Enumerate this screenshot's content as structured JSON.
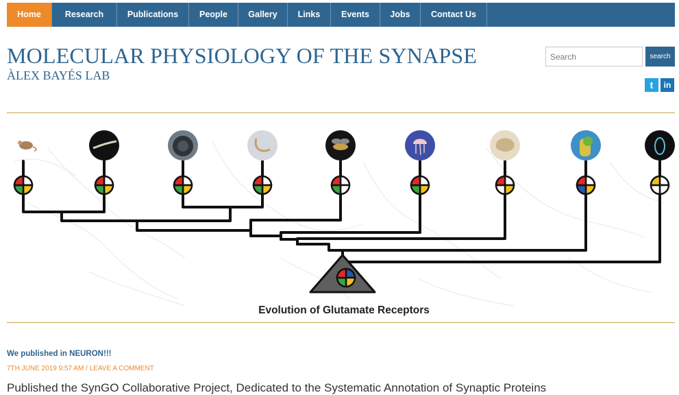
{
  "nav": {
    "items": [
      {
        "label": "Home",
        "active": true
      },
      {
        "label": "Research"
      },
      {
        "label": "Publications"
      },
      {
        "label": "People"
      },
      {
        "label": "Gallery"
      },
      {
        "label": "Links"
      },
      {
        "label": "Events"
      },
      {
        "label": "Jobs"
      },
      {
        "label": "Contact Us"
      }
    ]
  },
  "header": {
    "title": "MOLECULAR PHYSIOLOGY OF THE SYNAPSE",
    "subtitle": "ÀLEX BAYÉS LAB"
  },
  "search": {
    "placeholder": "Search",
    "button_label": "search"
  },
  "social": {
    "twitter_icon": "t",
    "linkedin_icon": "in"
  },
  "banner": {
    "caption": "Evolution of Glutamate Receptors"
  },
  "post": {
    "title": "We published in NEURON!!!",
    "date": "7th June 2019 9:57 am",
    "separator": "/",
    "comment_link": "LEAVE A COMMENT",
    "excerpt": "Published the SynGO Collaborative Project, Dedicated to the Systematic Annotation of Synaptic Proteins"
  },
  "colors": {
    "nav_bg": "#2f6691",
    "accent_orange": "#ee8a2a",
    "title_blue": "#2e6590",
    "rule_gold": "#c9a64d"
  }
}
